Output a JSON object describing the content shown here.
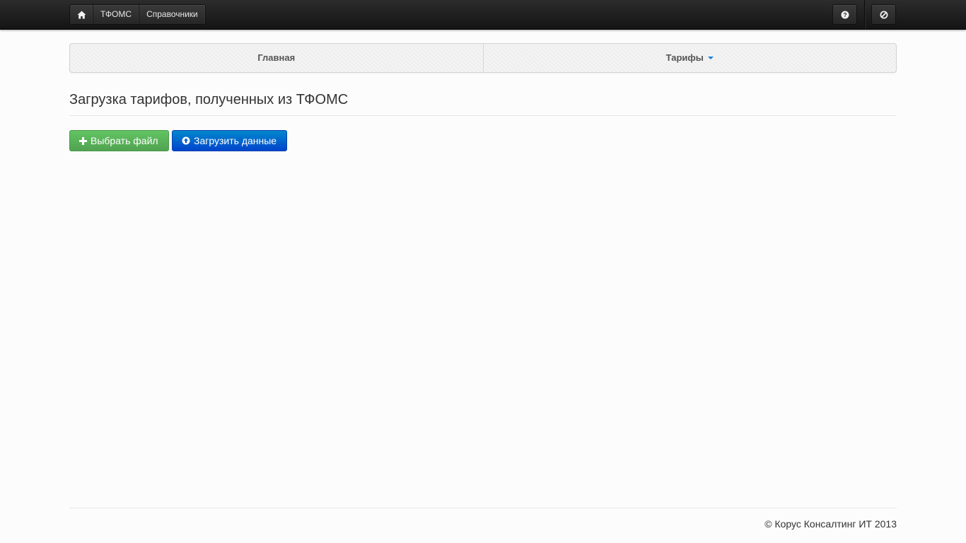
{
  "topbar": {
    "nav": [
      {
        "icon": "home-icon"
      },
      {
        "label": "ТФОМС"
      },
      {
        "label": "Справочники"
      }
    ],
    "right_icons": [
      "help-icon",
      "logout-icon"
    ]
  },
  "tabs": [
    {
      "label": "Главная"
    },
    {
      "label": "Тарифы",
      "has_dropdown": true
    }
  ],
  "page": {
    "title": "Загрузка тарифов, полученных из ТФОМС",
    "buttons": {
      "choose_file": "Выбрать файл",
      "upload_data": "Загрузить данные"
    }
  },
  "footer": {
    "copyright": "© Корус Консалтинг ИТ 2013"
  },
  "colors": {
    "green_button": "#5bb75b",
    "blue_button": "#0066cc",
    "caret": "#1f7fd6"
  }
}
